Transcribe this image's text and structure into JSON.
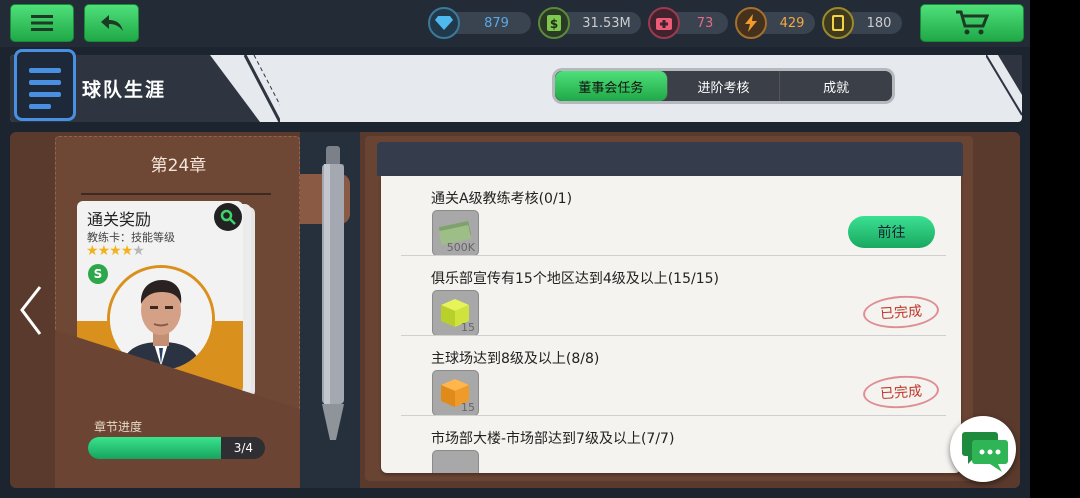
{
  "topbar": {
    "menu_icon": "hamburger-icon",
    "back_icon": "back-arrow-icon",
    "resources": [
      {
        "name": "diamond",
        "icon": "diamond-icon",
        "value": "879",
        "color": "#4fb9ef",
        "value_color": "#5aa9e6"
      },
      {
        "name": "cash",
        "icon": "cash-icon",
        "value": "31.53M",
        "color": "#7ec850",
        "value_color": "#cfcfcf"
      },
      {
        "name": "medkit",
        "icon": "medkit-icon",
        "value": "73",
        "color": "#ec5b7a",
        "value_color": "#e56a85"
      },
      {
        "name": "energy",
        "icon": "lightning-icon",
        "value": "429",
        "color": "#f39a2a",
        "value_color": "#f5a742"
      },
      {
        "name": "card",
        "icon": "card-icon",
        "value": "180",
        "color": "#f4d442",
        "value_color": "#cfcfcf"
      }
    ],
    "cart_icon": "cart-icon"
  },
  "header": {
    "title": "球队生涯",
    "tabs": [
      {
        "label": "董事会任务",
        "active": true
      },
      {
        "label": "进阶考核",
        "active": false
      },
      {
        "label": "成就",
        "active": false
      }
    ]
  },
  "left_panel": {
    "chapter": "第24章",
    "card": {
      "title": "通关奖励",
      "subtitle": "教练卡：技能等级",
      "stars_filled": 4,
      "stars_total": 5,
      "badge_letter": "S"
    },
    "progress": {
      "label": "章节进度",
      "text": "3/4",
      "fraction": 0.75
    }
  },
  "tasks": [
    {
      "title": "通关A级教练考核(0/1)",
      "icon": "cash-stack-icon",
      "count": "500K",
      "status": "goto",
      "action_label": "前往"
    },
    {
      "title": "俱乐部宣传有15个地区达到4级及以上(15/15)",
      "icon": "green-box-icon",
      "count": "15",
      "status": "done",
      "action_label": "已完成"
    },
    {
      "title": "主球场达到8级及以上(8/8)",
      "icon": "orange-box-icon",
      "count": "15",
      "status": "done",
      "action_label": "已完成"
    },
    {
      "title": "市场部大楼-市场部达到7级及以上(7/7)",
      "icon": "item-icon",
      "count": "",
      "status": "done",
      "action_label": ""
    }
  ]
}
